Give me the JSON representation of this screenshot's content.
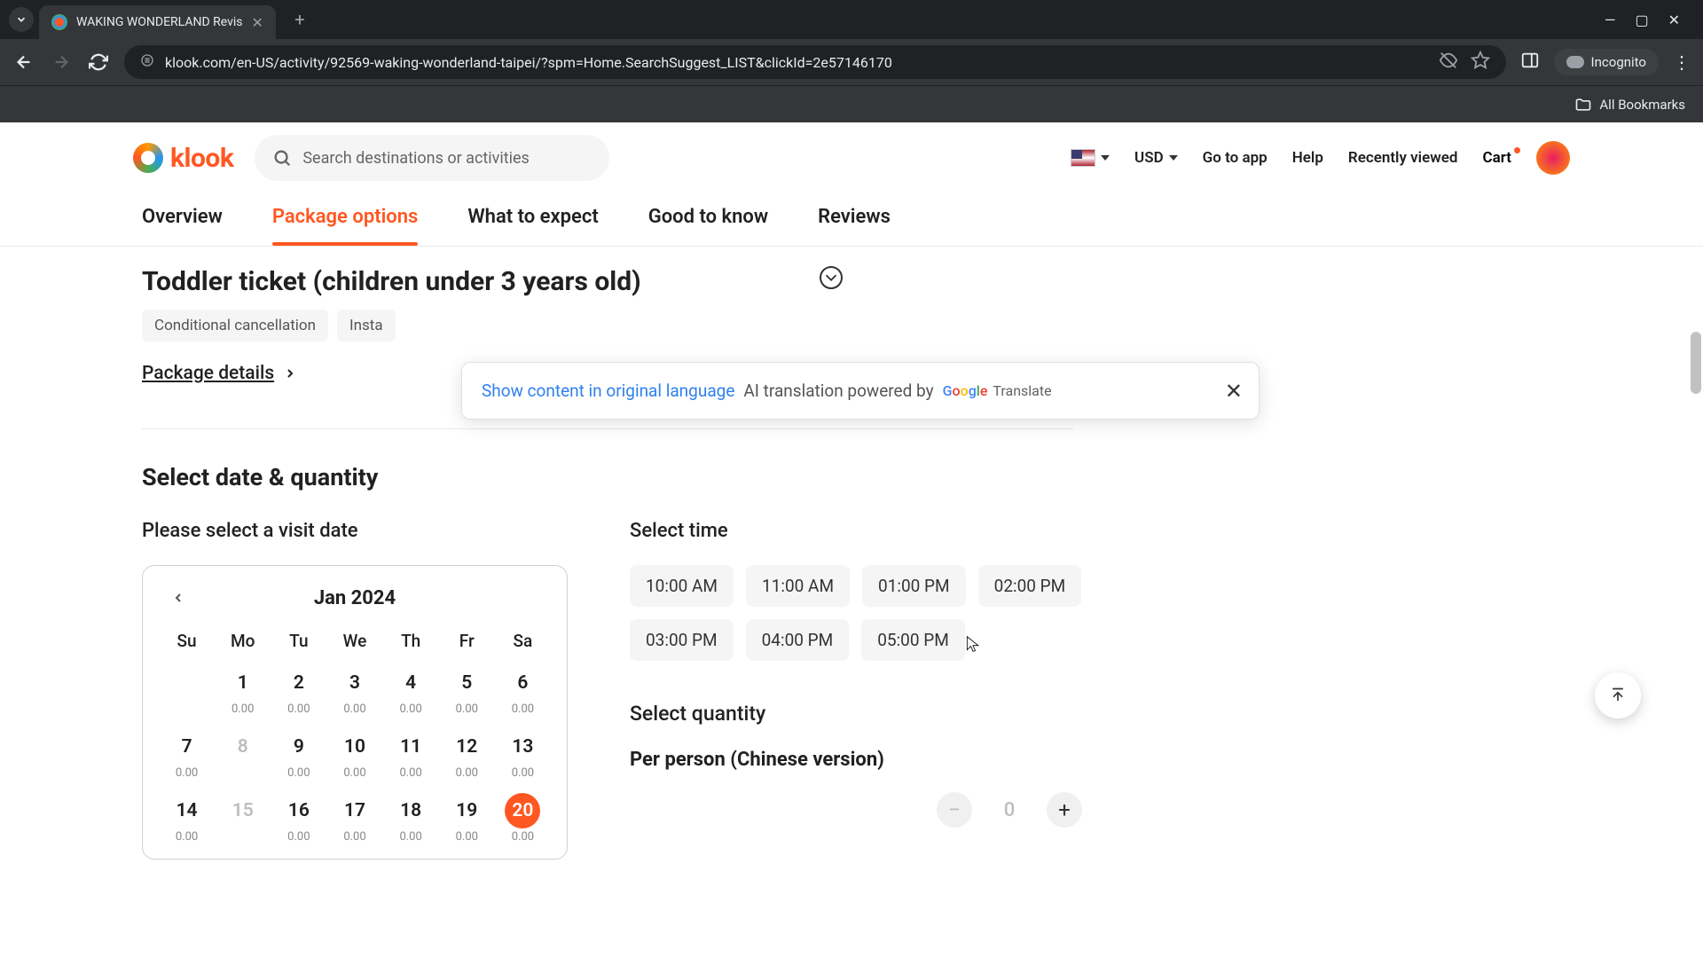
{
  "browser": {
    "tab_title": "WAKING WONDERLAND Revis",
    "url": "klook.com/en-US/activity/92569-waking-wonderland-taipei/?spm=Home.SearchSuggest_LIST&clickId=2e57146170",
    "incognito_label": "Incognito",
    "bookmarks_label": "All Bookmarks"
  },
  "header": {
    "brand": "klook",
    "search_placeholder": "Search destinations or activities",
    "currency": "USD",
    "links": {
      "go_to_app": "Go to app",
      "help": "Help",
      "recently_viewed": "Recently viewed",
      "cart": "Cart"
    }
  },
  "tabs": {
    "overview": "Overview",
    "package_options": "Package options",
    "what_to_expect": "What to expect",
    "good_to_know": "Good to know",
    "reviews": "Reviews"
  },
  "package": {
    "title": "Toddler ticket (children under 3 years old)",
    "tags": {
      "conditional": "Conditional cancellation",
      "instant": "Insta"
    },
    "details_link": "Package details"
  },
  "translation_banner": {
    "link": "Show content in original language",
    "text": "AI translation powered by",
    "translate_word": "Translate"
  },
  "booking": {
    "section_title": "Select date & quantity",
    "date_label": "Please select a visit date",
    "time_label": "Select time",
    "qty_label": "Select quantity",
    "qty_name": "Per person (Chinese version)",
    "qty_value": "0"
  },
  "calendar": {
    "month": "Jan 2024",
    "dow": [
      "Su",
      "Mo",
      "Tu",
      "We",
      "Th",
      "Fr",
      "Sa"
    ],
    "weeks": [
      [
        {
          "d": ""
        },
        {
          "d": "1",
          "p": "0.00"
        },
        {
          "d": "2",
          "p": "0.00"
        },
        {
          "d": "3",
          "p": "0.00"
        },
        {
          "d": "4",
          "p": "0.00"
        },
        {
          "d": "5",
          "p": "0.00"
        },
        {
          "d": "6",
          "p": "0.00"
        }
      ],
      [
        {
          "d": "7",
          "p": "0.00"
        },
        {
          "d": "8",
          "p": "",
          "disabled": true
        },
        {
          "d": "9",
          "p": "0.00"
        },
        {
          "d": "10",
          "p": "0.00"
        },
        {
          "d": "11",
          "p": "0.00"
        },
        {
          "d": "12",
          "p": "0.00"
        },
        {
          "d": "13",
          "p": "0.00"
        }
      ],
      [
        {
          "d": "14",
          "p": "0.00"
        },
        {
          "d": "15",
          "p": "",
          "disabled": true
        },
        {
          "d": "16",
          "p": "0.00"
        },
        {
          "d": "17",
          "p": "0.00"
        },
        {
          "d": "18",
          "p": "0.00"
        },
        {
          "d": "19",
          "p": "0.00"
        },
        {
          "d": "20",
          "p": "0.00",
          "selected": true
        }
      ]
    ]
  },
  "times": [
    "10:00 AM",
    "11:00 AM",
    "01:00 PM",
    "02:00 PM",
    "03:00 PM",
    "04:00 PM",
    "05:00 PM"
  ]
}
